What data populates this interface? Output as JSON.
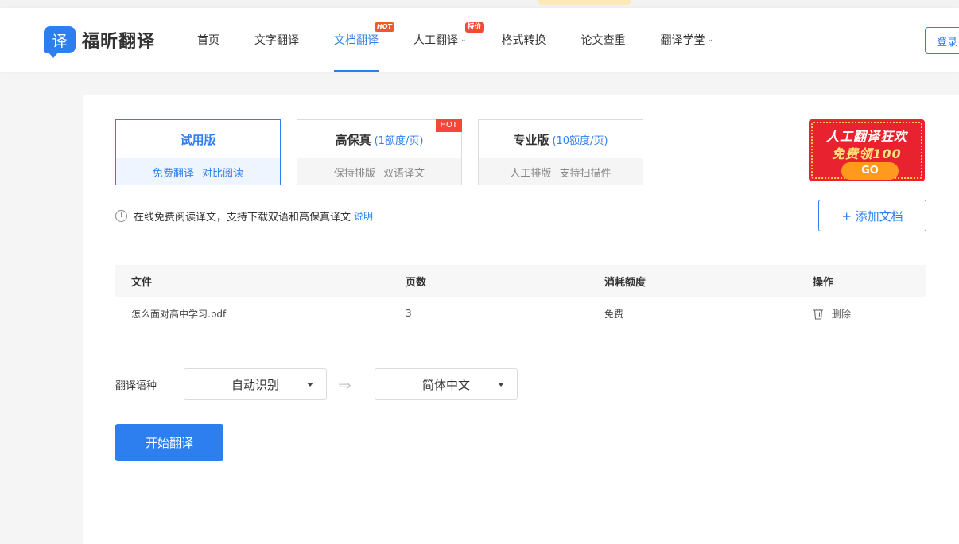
{
  "header": {
    "logo_glyph": "译",
    "logo_text": "福昕翻译",
    "nav": [
      {
        "label": "首页"
      },
      {
        "label": "文字翻译"
      },
      {
        "label": "文档翻译",
        "badge": "HOT",
        "active": true
      },
      {
        "label": "人工翻译",
        "badge": "特价",
        "caret": true
      },
      {
        "label": "格式转换"
      },
      {
        "label": "论文查重"
      },
      {
        "label": "翻译学堂",
        "caret": true
      }
    ],
    "login_label": "登录"
  },
  "plans": [
    {
      "title": "试用版",
      "credit": "",
      "sub": "免费翻译 对比阅读",
      "selected": true
    },
    {
      "title": "高保真",
      "credit": "(1额度/页)",
      "sub": "保持排版 双语译文",
      "hot": "HOT"
    },
    {
      "title": "专业版",
      "credit": "(10额度/页)",
      "sub": "人工排版 支持扫描件"
    }
  ],
  "promo": {
    "line1": "人工翻译狂欢",
    "line2": "免费领100",
    "go": "GO"
  },
  "notice": {
    "icon": "info-icon",
    "text": "在线免费阅读译文，支持下载双语和高保真译文",
    "link": "说明"
  },
  "add_doc_label": "+ 添加文档",
  "table": {
    "headers": [
      "文件",
      "页数",
      "消耗额度",
      "操作"
    ],
    "rows": [
      {
        "file": "怎么面对高中学习.pdf",
        "pages": "3",
        "cost": "免费",
        "action": "删除"
      }
    ]
  },
  "language": {
    "label": "翻译语种",
    "source": "自动识别",
    "target": "简体中文",
    "arrow": "⇒"
  },
  "start_label": "开始翻译",
  "colors": {
    "accent": "#2d7ff0",
    "hot": "#f2473a"
  }
}
